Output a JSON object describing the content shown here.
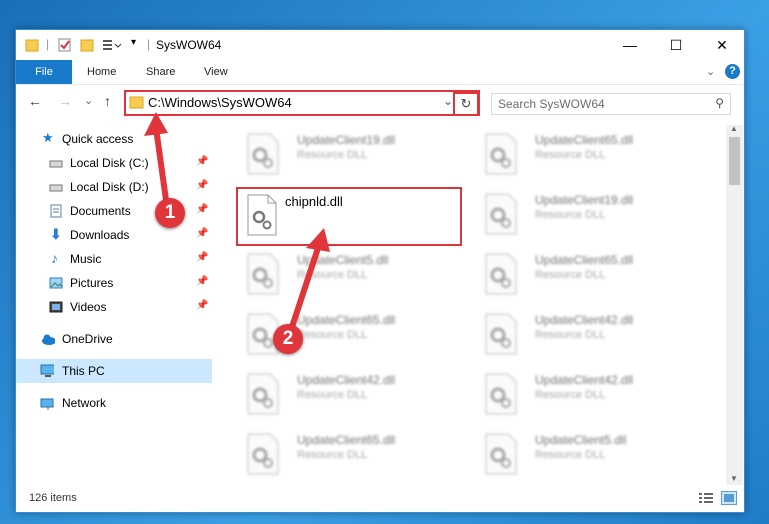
{
  "window": {
    "title": "SysWOW64",
    "minimize_glyph": "—",
    "maximize_glyph": "☐",
    "close_glyph": "✕"
  },
  "ribbon": {
    "tabs": [
      "File",
      "Home",
      "Share",
      "View"
    ],
    "expand_glyph": "⌄",
    "help_glyph": "?"
  },
  "nav": {
    "back_glyph": "←",
    "forward_glyph": "→",
    "recent_glyph": "⌄",
    "up_glyph": "↑"
  },
  "address": {
    "path": "C:\\Windows\\SysWOW64",
    "dropdown_glyph": "⌄",
    "refresh_glyph": "↻"
  },
  "search": {
    "placeholder": "Search SysWOW64",
    "icon_glyph": "⚲"
  },
  "sidebar": {
    "items": [
      {
        "label": "Quick access",
        "icon": "star-icon"
      },
      {
        "label": "Local Disk (C:)",
        "icon": "drive-icon",
        "pinned": true
      },
      {
        "label": "Local Disk (D:)",
        "icon": "drive-icon",
        "pinned": true
      },
      {
        "label": "Documents",
        "icon": "documents-icon",
        "pinned": true
      },
      {
        "label": "Downloads",
        "icon": "download-icon",
        "pinned": true
      },
      {
        "label": "Music",
        "icon": "music-icon",
        "pinned": true
      },
      {
        "label": "Pictures",
        "icon": "pictures-icon",
        "pinned": true
      },
      {
        "label": "Videos",
        "icon": "videos-icon",
        "pinned": true
      },
      {
        "label": "OneDrive",
        "icon": "cloud-icon"
      },
      {
        "label": "This PC",
        "icon": "computer-icon",
        "selected": true
      },
      {
        "label": "Network",
        "icon": "network-icon"
      }
    ],
    "pin_glyph": "📌"
  },
  "files": {
    "col1": [
      {
        "name": "UpdateClient19.dll",
        "type": "Resource DLL"
      },
      {
        "name": "UpdateClient5.dll",
        "type": "Resource DLL"
      },
      {
        "name": "UpdateClient65.dll",
        "type": "Resource DLL"
      },
      {
        "name": "UpdateClient42.dll",
        "type": "Resource DLL"
      },
      {
        "name": "UpdateClient65.dll",
        "type": "Resource DLL"
      }
    ],
    "col2": [
      {
        "name": "UpdateClient65.dll",
        "type": "Resource DLL"
      },
      {
        "name": "UpdateClient19.dll",
        "type": "Resource DLL"
      },
      {
        "name": "UpdateClient65.dll",
        "type": "Resource DLL"
      },
      {
        "name": "UpdateClient42.dll",
        "type": "Resource DLL"
      },
      {
        "name": "UpdateClient42.dll",
        "type": "Resource DLL"
      },
      {
        "name": "UpdateClient5.dll",
        "type": "Resource DLL"
      }
    ],
    "highlighted": {
      "name": "chipnld.dll"
    }
  },
  "scroll": {
    "up_glyph": "▲",
    "down_glyph": "▼"
  },
  "status": {
    "count": "126 items"
  },
  "annotations": {
    "step1": "1",
    "step2": "2"
  },
  "colors": {
    "accent": "#1979ca",
    "highlight": "#e0333a"
  }
}
